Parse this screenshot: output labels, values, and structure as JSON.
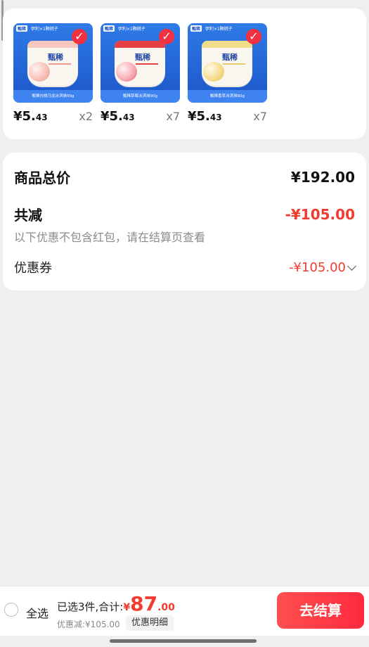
{
  "products": [
    {
      "brand": "甄稀",
      "top_text": "伊利×1颗桃子",
      "bottom_text": "甄稀白桃乌龙冰淇淋90g",
      "price_main": "¥5.",
      "price_decimal": "43",
      "qty": "x2"
    },
    {
      "brand": "甄稀",
      "top_text": "伊利×1颗桃子",
      "bottom_text": "甄稀草莓冰淇淋90g",
      "price_main": "¥5.",
      "price_decimal": "43",
      "qty": "x7"
    },
    {
      "brand": "甄稀",
      "top_text": "伊利×1颗桃子",
      "bottom_text": "甄稀香草冰淇淋90g",
      "price_main": "¥5.",
      "price_decimal": "43",
      "qty": "x7"
    }
  ],
  "summary": {
    "goods_total_label": "商品总价",
    "goods_total_value": "¥192.00",
    "reduce_label": "共减",
    "reduce_value": "-¥105.00",
    "note": "以下优惠不包含红包，请在结算页查看",
    "coupon_label": "优惠券",
    "coupon_value": "-¥105.00"
  },
  "bottom_bar": {
    "select_all": "全选",
    "selected_text": "已选3件,合计:",
    "currency": "¥",
    "total_major": "87",
    "total_decimal": ".00",
    "discount_text": "优惠减:¥105.00",
    "details_button": "优惠明细",
    "checkout_button": "去结算"
  },
  "icons": {
    "check": "checkmark-icon",
    "radio": "radio-icon",
    "chevron": "chevron-down-icon"
  },
  "colors": {
    "accent_red": "#f13b2f",
    "brand_blue": "#1c55c7",
    "background": "#efefef",
    "card": "#ffffff"
  }
}
